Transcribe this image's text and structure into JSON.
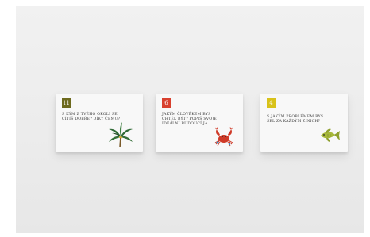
{
  "cards": [
    {
      "number": "11",
      "accent": "#6d6a1e",
      "question": "S kým z tvého okolí se cítíš dobře? Díky čemu?",
      "icon": "palm-tree-icon"
    },
    {
      "number": "6",
      "accent": "#d8402e",
      "question": "Jakým člověkem bys chtěl být? Popiš svoje ideální budoucí já.",
      "icon": "crab-icon"
    },
    {
      "number": "4",
      "accent": "#d8c21a",
      "label": "",
      "question": "S jakým problémem bys šel za každým z nich?",
      "icon": "fish-icon"
    }
  ]
}
